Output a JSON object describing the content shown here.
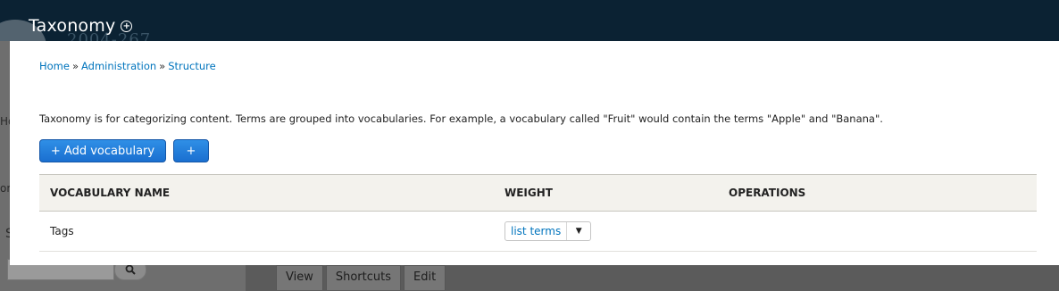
{
  "header": {
    "title": "Taxonomy",
    "shortcut_icon": "plus-circle-icon",
    "watermark": "2004-267"
  },
  "backdrop": {
    "text1": "Ho",
    "text2": "om",
    "text3": "S",
    "search_icon": "magnifier-icon",
    "tabs": [
      "View",
      "Shortcuts",
      "Edit"
    ]
  },
  "breadcrumb": {
    "items": [
      "Home",
      "Administration",
      "Structure"
    ],
    "separator": "»"
  },
  "help_text": "Taxonomy is for categorizing content. Terms are grouped into vocabularies. For example, a vocabulary called \"Fruit\" would contain the terms \"Apple\" and \"Banana\".",
  "actions": {
    "add_vocabulary": "+ Add vocabulary",
    "plus": "+"
  },
  "table": {
    "headers": [
      "VOCABULARY NAME",
      "WEIGHT",
      "OPERATIONS"
    ],
    "rows": [
      {
        "name": "Tags",
        "operation_label": "list terms",
        "toggle_icon": "caret-down-icon"
      }
    ]
  },
  "colors": {
    "header_bg": "#0b2233",
    "link": "#0074bd",
    "button": "#1a6fd0",
    "table_head_bg": "#f3f2ed"
  }
}
